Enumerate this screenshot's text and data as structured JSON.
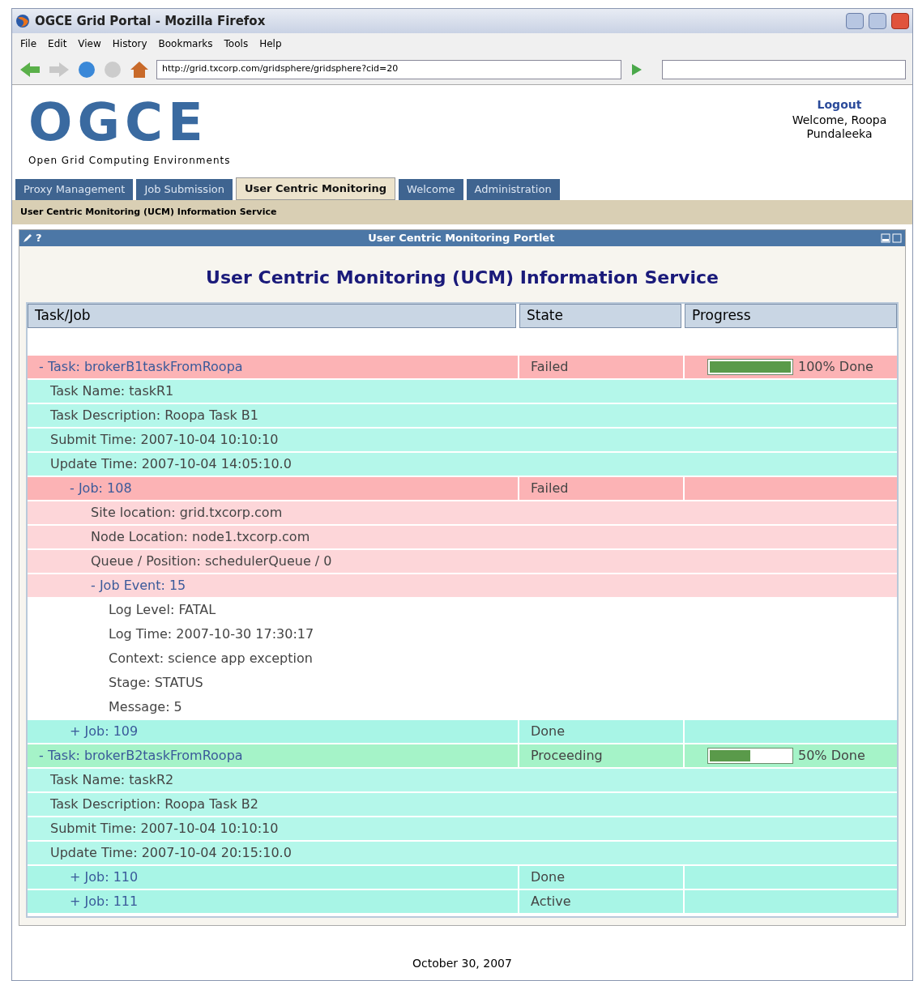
{
  "window": {
    "title": "OGCE Grid Portal - Mozilla Firefox"
  },
  "menu": [
    "File",
    "Edit",
    "View",
    "History",
    "Bookmarks",
    "Tools",
    "Help"
  ],
  "address": "http://grid.txcorp.com/gridsphere/gridsphere?cid=20",
  "logo": {
    "text": "OGCE",
    "subtitle": "Open Grid Computing Environments"
  },
  "user": {
    "logout": "Logout",
    "welcome": "Welcome, Roopa Pundaleeka"
  },
  "tabs": [
    {
      "label": "Proxy Management",
      "selected": false
    },
    {
      "label": "Job Submission",
      "selected": false
    },
    {
      "label": "User Centric Monitoring",
      "selected": true
    },
    {
      "label": "Welcome",
      "selected": false
    },
    {
      "label": "Administration",
      "selected": false
    }
  ],
  "breadcrumb": "User Centric Monitoring (UCM) Information Service",
  "portlet": {
    "title": "User Centric Monitoring Portlet",
    "help": "?",
    "heading": "User Centric Monitoring (UCM) Information Service"
  },
  "table": {
    "columns": [
      "Task/Job",
      "State",
      "Progress"
    ],
    "tasks": [
      {
        "toggle": "-",
        "label": "Task: brokerB1taskFromRoopa",
        "state": "Failed",
        "kind": "failed",
        "level": 1,
        "reading": "100% Done",
        "details": [
          "Task Name: taskR1",
          "Task Description: Roopa Task B1",
          "Submit Time: 2007-10-04 10:10:10",
          "Update Time: 2007-10-04 14:05:10.0"
        ],
        "children": [
          {
            "toggle": "-",
            "label": "Job: 108",
            "state": "Failed",
            "kind": "failed",
            "details": [
              "Site location: grid.txcorp.com",
              "Node Location: node1.txcorp.com",
              "Queue / Position: schedulerQueue / 0"
            ],
            "children": [
              {
                "toggle": "-",
                "label": "Job Event: 15",
                "details": [
                  "Log Level: FATAL",
                  "Log Time: 2007-10-30 17:30:17",
                  "Context: science app exception",
                  "Stage: STATUS",
                  "Message: 5"
                ]
              }
            ]
          },
          {
            "toggle": "+",
            "label": "Job: 109",
            "state": "Done",
            "kind": "done"
          }
        ]
      },
      {
        "toggle": "-",
        "label": "Task: brokerB2taskFromRoopa",
        "state": "Proceeding",
        "kind": "proceeding",
        "level": 0.5,
        "reading": "50% Done",
        "details": [
          "Task Name: taskR2",
          "Task Description: Roopa Task B2",
          "Submit Time: 2007-10-04 10:10:10",
          "Update Time: 2007-10-04 20:15:10.0"
        ],
        "children": [
          {
            "toggle": "+",
            "label": "Job: 110",
            "state": "Done",
            "kind": "done"
          },
          {
            "toggle": "+",
            "label": "Job: 111",
            "state": "Active",
            "kind": "active"
          }
        ]
      }
    ]
  },
  "footer": "October 30, 2007"
}
